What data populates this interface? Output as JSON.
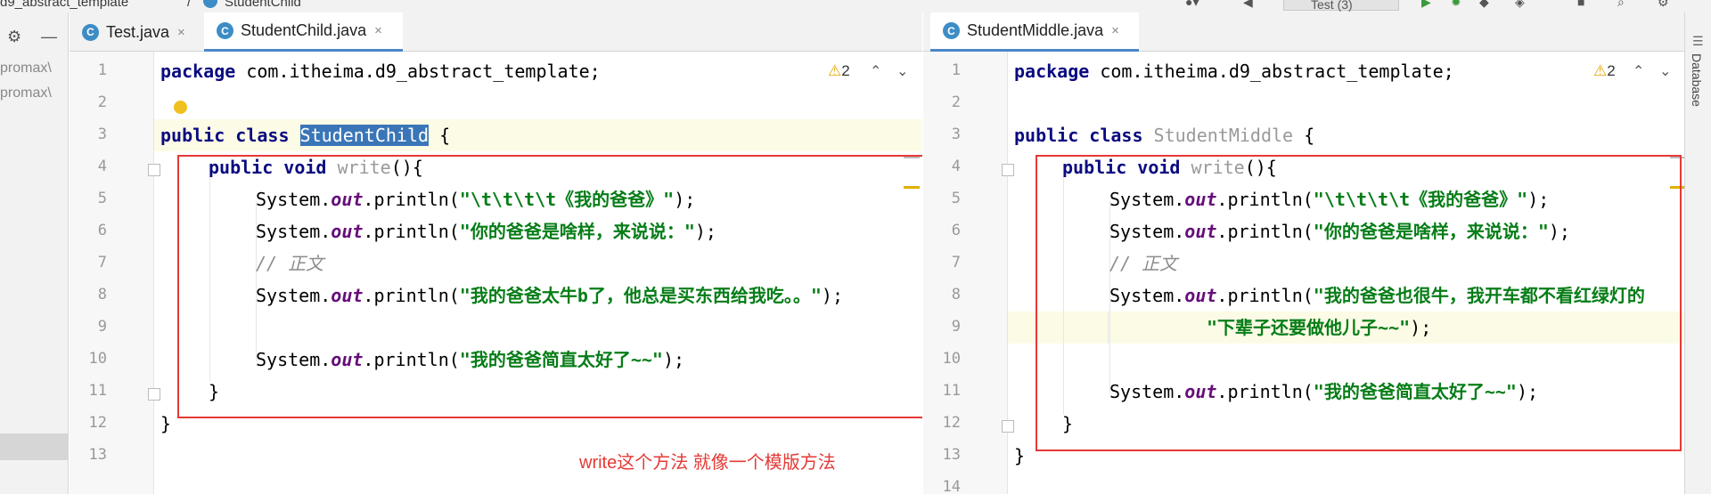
{
  "breadcrumb": {
    "package": "d9_abstract_template",
    "separator": "/",
    "file": "StudentChild"
  },
  "toolbar": {
    "run_config": "Test (3)"
  },
  "project_strip": {
    "settings_icon": "gear-icon",
    "collapse_icon": "minus-icon",
    "text1": "promax\\",
    "text2": "promax\\"
  },
  "left_tabs": [
    {
      "label": "Test.java",
      "icon": "java-class-icon",
      "close": "×"
    },
    {
      "label": "StudentChild.java",
      "icon": "java-class-icon",
      "close": "×"
    }
  ],
  "right_tabs": [
    {
      "label": "StudentMiddle.java",
      "icon": "java-class-icon",
      "close": "×"
    }
  ],
  "left_editor": {
    "line_numbers": [
      "1",
      "2",
      "3",
      "4",
      "5",
      "6",
      "7",
      "8",
      "9",
      "10",
      "11",
      "12",
      "13"
    ],
    "warning_count": "2",
    "code": {
      "l1_kw": "package",
      "l1_rest": " com.itheima.d9_abstract_template;",
      "l3_kw": "public class",
      "l3_name": "StudentChild",
      "l3_rest": " {",
      "l4_kw": "public void",
      "l4_name": "write",
      "l4_rest": "(){",
      "sys": "System.",
      "out": "out",
      "println": ".println(",
      "l5_str": "\"\\t\\t\\t\\t《我的爸爸》\"",
      "l5_end": ");",
      "l6_str": "\"你的爸爸是啥样，来说说：\"",
      "l6_end": ");",
      "l7_cmt": "// 正文",
      "l8_str": "\"我的爸爸太牛b了，他总是买东西给我吃。。\"",
      "l8_end": ");",
      "l10_str": "\"我的爸爸简直太好了~~\"",
      "l10_end": ");",
      "l11": "}",
      "l12": "}"
    }
  },
  "right_editor": {
    "line_numbers": [
      "1",
      "2",
      "3",
      "4",
      "5",
      "6",
      "7",
      "8",
      "9",
      "10",
      "11",
      "12",
      "13",
      "14"
    ],
    "warning_count": "2",
    "code": {
      "l1_kw": "package",
      "l1_rest": " com.itheima.d9_abstract_template;",
      "l3_kw": "public class",
      "l3_name": "StudentMiddle",
      "l3_rest": " {",
      "l4_kw": "public void",
      "l4_name": "write",
      "l4_rest": "(){",
      "sys": "System.",
      "out": "out",
      "println": ".println(",
      "l5_str": "\"\\t\\t\\t\\t《我的爸爸》\"",
      "l5_end": ");",
      "l6_str": "\"你的爸爸是啥样，来说说：\"",
      "l6_end": ");",
      "l7_cmt": "// 正文",
      "l8_str": "\"我的爸爸也很牛，我开车都不看红绿灯的",
      "l9_str": "\"下辈子还要做他儿子~~\"",
      "l9_end": ");",
      "l11_str": "\"我的爸爸简直太好了~~\"",
      "l11_end": ");",
      "l12": "}",
      "l13": "}"
    }
  },
  "annotation": "write这个方法 就像一个模版方法",
  "right_strip": {
    "label": "Database",
    "icon": "database-icon"
  },
  "colors": {
    "annotation": "#e53935",
    "keyword": "#0a0a80",
    "string": "#067d17",
    "field": "#660e7a",
    "selection": "#3a76b7"
  }
}
